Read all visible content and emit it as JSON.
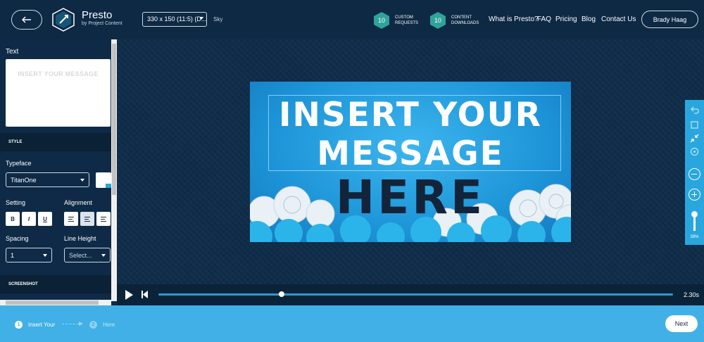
{
  "header": {
    "brand_name": "Presto",
    "brand_sub": "by Project Content",
    "size_select": "330 x 150 (11:5) (D...",
    "theme_label": "Sky",
    "counters": [
      {
        "value": "10",
        "label": "CUSTOM REQUESTS"
      },
      {
        "value": "10",
        "label": "CONTENT DOWNLOADS"
      }
    ],
    "nav": [
      "What is Presto?",
      "FAQ",
      "Pricing",
      "Blog",
      "Contact Us"
    ],
    "user": "Brady Haag"
  },
  "panel": {
    "text_label": "Text",
    "text_preview": "INSERT YOUR MESSAGE",
    "style_heading": "STYLE",
    "typeface_label": "Typeface",
    "typeface_value": "TitanOne",
    "setting_label": "Setting",
    "setting_buttons": [
      "B",
      "I",
      "U"
    ],
    "alignment_label": "Alignment",
    "spacing_label": "Spacing",
    "spacing_value": "1",
    "line_height_label": "Line Height",
    "line_height_placeholder": "Select...",
    "screenshot_heading": "SCREENSHOT"
  },
  "canvas": {
    "line1": "INSERT YOUR",
    "line2": "MESSAGE",
    "line3": "HERE",
    "zoom_percent": "39%",
    "zoom_level": 0.39
  },
  "playbar": {
    "time": "2.30s",
    "progress": 0.24
  },
  "footer": {
    "steps": [
      {
        "num": "1",
        "label": "Insert Your"
      },
      {
        "num": "2",
        "label": "Here"
      }
    ],
    "next": "Next"
  },
  "colors": {
    "header_bg": "#0d2944",
    "accent": "#2aa6df",
    "footer_bg": "#40b0e6",
    "badge": "#2fa39a",
    "text_dark": "#13233a"
  }
}
